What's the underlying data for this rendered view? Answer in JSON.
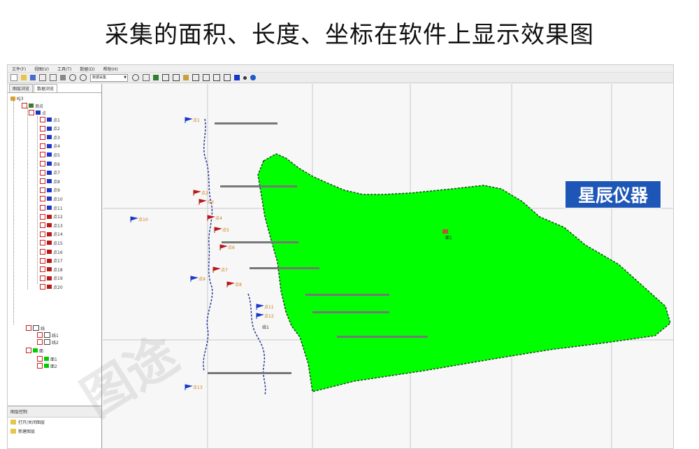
{
  "headline": "采集的面积、长度、坐标在软件上显示效果图",
  "brand": "星辰仪器",
  "watermark": "图途",
  "app": {
    "menu": [
      "文件(F)",
      "视图(V)",
      "工具(T)",
      "数据(D)",
      "帮助(H)"
    ],
    "toolbar": {
      "combo_value": "数据采集"
    },
    "panel_tabs": [
      "图层浏览",
      "数据浏览"
    ],
    "tree": {
      "root": "KJ3",
      "group_points": "测点",
      "subgroup": "点",
      "point_items": [
        "点1",
        "点2",
        "点3",
        "点4",
        "点5",
        "点6",
        "点7",
        "点8",
        "点9",
        "点10",
        "点11",
        "点12",
        "点13",
        "点14",
        "点15",
        "点16",
        "点17",
        "点18",
        "点19",
        "点20"
      ],
      "line_group": "线",
      "line_items": [
        "线1",
        "线2"
      ],
      "area_group": "面",
      "area_items": [
        "面1",
        "面2"
      ]
    },
    "layer_panel": {
      "title": "图层控制",
      "items": [
        "打开/关闭图层",
        "新建图层"
      ]
    },
    "map": {
      "point_labels": [
        "点1",
        "点2",
        "点3",
        "点4",
        "点5",
        "点6",
        "点7",
        "点8",
        "点9",
        "点10",
        "点11",
        "点12",
        "点13"
      ],
      "line_label": "线1",
      "area_label": "面1"
    }
  },
  "colors": {
    "polygon": "#00ff00",
    "brand_bg": "#1e56b8",
    "track": "#2a3a9a",
    "flag_blue": "#1a36c8",
    "flag_red": "#b81818"
  }
}
